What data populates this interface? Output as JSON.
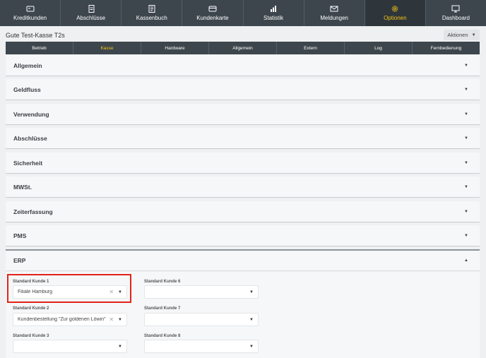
{
  "nav": {
    "items": [
      {
        "label": "Kreditkunden",
        "icon": "credit-card-icon"
      },
      {
        "label": "Abschlüsse",
        "icon": "document-icon"
      },
      {
        "label": "Kassenbuch",
        "icon": "ledger-icon"
      },
      {
        "label": "Kundenkarte",
        "icon": "card-icon"
      },
      {
        "label": "Statistik",
        "icon": "chart-icon"
      },
      {
        "label": "Meldungen",
        "icon": "envelope-icon"
      },
      {
        "label": "Optionen",
        "icon": "gear-icon"
      },
      {
        "label": "Dashboard",
        "icon": "monitor-icon"
      }
    ],
    "active_color": "#f2c315"
  },
  "page": {
    "title": "Gute Test-Kasse T2s",
    "actions_label": "Aktionen"
  },
  "subtabs": [
    "Betrieb",
    "Kasse",
    "Hardware",
    "Allgemein",
    "Extern",
    "Log",
    "Fernbedienung"
  ],
  "sections": [
    "Allgemein",
    "Geldfluss",
    "Verwendung",
    "Abschlüsse",
    "Sicherheit",
    "MWSt.",
    "Zeiterfassung",
    "PMS",
    "ERP"
  ],
  "erp": {
    "fields": [
      {
        "label": "Standard Kunde 1",
        "value": "Filiale Hamburg",
        "clearable": true
      },
      {
        "label": "Standard Kunde 2",
        "value": "Kundenbestellung \"Zur goldenen Löwin\"",
        "clearable": true
      },
      {
        "label": "Standard Kunde 3",
        "value": "",
        "clearable": false
      },
      {
        "label": "Standard Kunde 6",
        "value": "",
        "clearable": false
      },
      {
        "label": "Standard Kunde 7",
        "value": "",
        "clearable": false
      },
      {
        "label": "Standard Kunde 8",
        "value": "",
        "clearable": false
      }
    ],
    "clear_glyph": "✕",
    "highlight_color": "#e2231a"
  }
}
